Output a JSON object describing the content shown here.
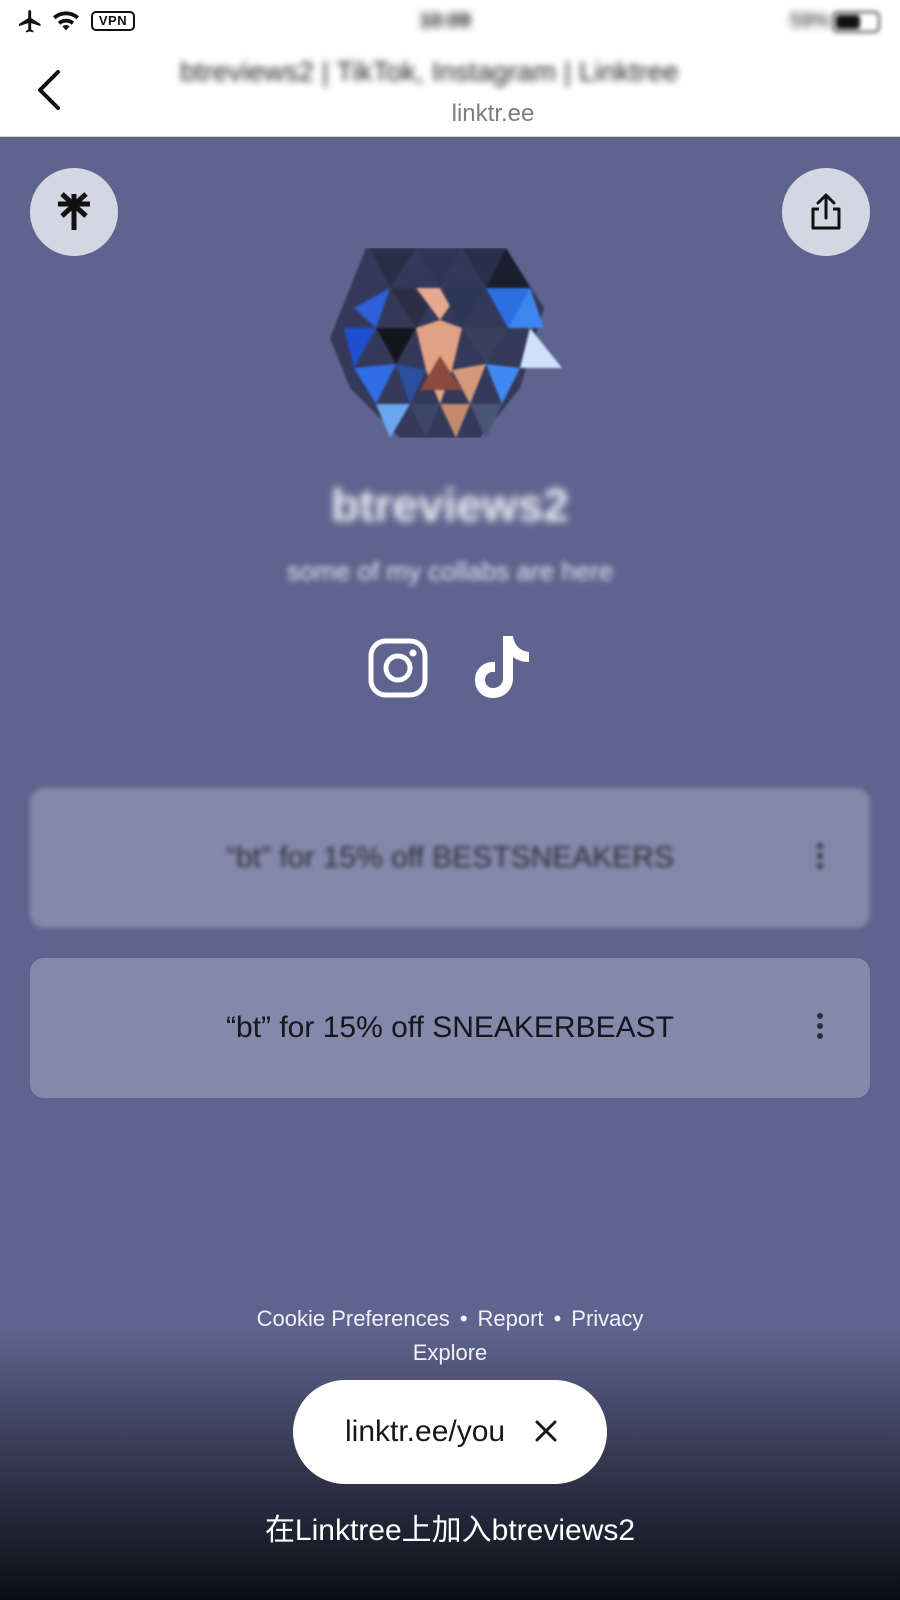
{
  "status_bar": {
    "vpn_label": "VPN",
    "time": "10:09",
    "battery_text": "59%",
    "battery_level": 0.59
  },
  "header": {
    "title": "btreviews2 | TikTok, Instagram | Linktree",
    "url": "linktr.ee"
  },
  "profile": {
    "name": "btreviews2",
    "bio": "some of my collabs are here"
  },
  "social": [
    "instagram-icon",
    "tiktok-icon"
  ],
  "links": [
    {
      "label": "“bt” for 15% off BESTSNEAKERS"
    },
    {
      "label": "“bt” for 15% off SNEAKERBEAST"
    }
  ],
  "footer": {
    "cookie": "Cookie Preferences",
    "report": "Report",
    "privacy": "Privacy",
    "separator": "•",
    "explore": "Explore",
    "claim": "linktr.ee/you",
    "join": "在Linktree上加入btreviews2"
  },
  "colors": {
    "background": "#5e648e",
    "card": "#8488aa",
    "header": "#ffffff"
  }
}
